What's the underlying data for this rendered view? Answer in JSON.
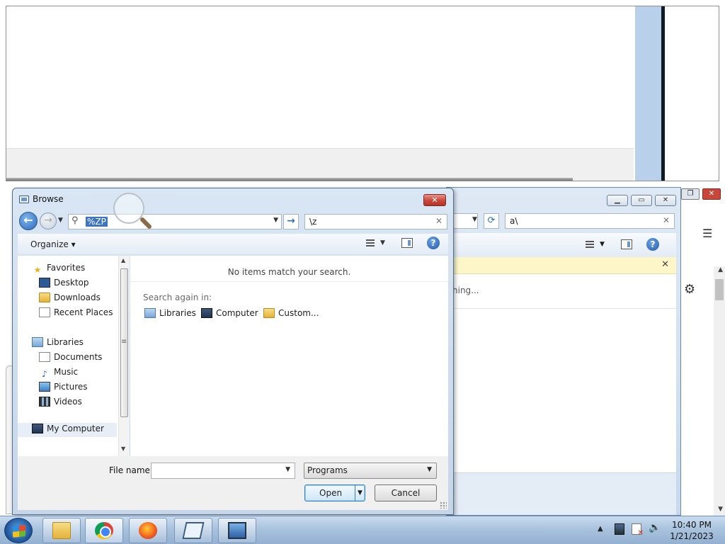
{
  "dialog": {
    "title": "Browse",
    "address_value": "%ZP",
    "search_value": "\\z",
    "toolbar": {
      "organize_label": "Organize"
    },
    "nav": {
      "favorites_label": "Favorites",
      "favorites": [
        "Desktop",
        "Downloads",
        "Recent Places"
      ],
      "libraries_label": "Libraries",
      "libraries": [
        "Documents",
        "Music",
        "Pictures",
        "Videos"
      ],
      "computer_label": "My Computer"
    },
    "main": {
      "no_items_message": "No items match your search.",
      "search_again_label": "Search again in:",
      "locations": [
        "Libraries",
        "Computer",
        "Custom..."
      ]
    },
    "file_name_label": "File name:",
    "file_name_value": "",
    "file_type_value": "Programs",
    "open_label": "Open",
    "cancel_label": "Cancel"
  },
  "background_window": {
    "search_value": "a\\",
    "searching_text": "hing..."
  },
  "taskbar": {
    "time": "10:40 PM",
    "date": "1/21/2023",
    "apps": [
      "windows-explorer",
      "google-chrome",
      "firefox",
      "program-window",
      "remote-monitor"
    ]
  }
}
